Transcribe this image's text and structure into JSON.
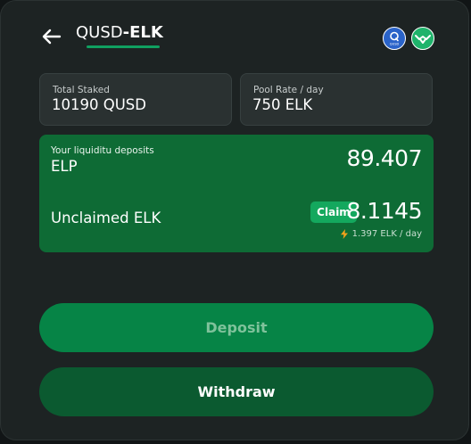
{
  "header": {
    "token_a": "QUSD",
    "token_b": "-ELK",
    "icon_a_text": "QUSD"
  },
  "stats": {
    "total_staked_label": "Total Staked",
    "total_staked_value": "10190 QUSD",
    "pool_rate_label": "Pool Rate / day",
    "pool_rate_value": "750 ELK"
  },
  "deposits": {
    "label": "Your liquiditu deposits",
    "token": "ELP",
    "value": "89.407"
  },
  "rewards": {
    "label": "Unclaimed ELK",
    "claim_label": "Claim",
    "value": "8.1145",
    "rate": "1.397 ELK / day"
  },
  "actions": {
    "deposit_label": "Deposit",
    "withdraw_label": "Withdraw"
  },
  "colors": {
    "accent_green": "#068446",
    "panel_green": "#0e6b35",
    "claim_green": "#14a85e",
    "qusd_blue": "#2a63c9",
    "bolt_orange": "#f2a21b"
  }
}
